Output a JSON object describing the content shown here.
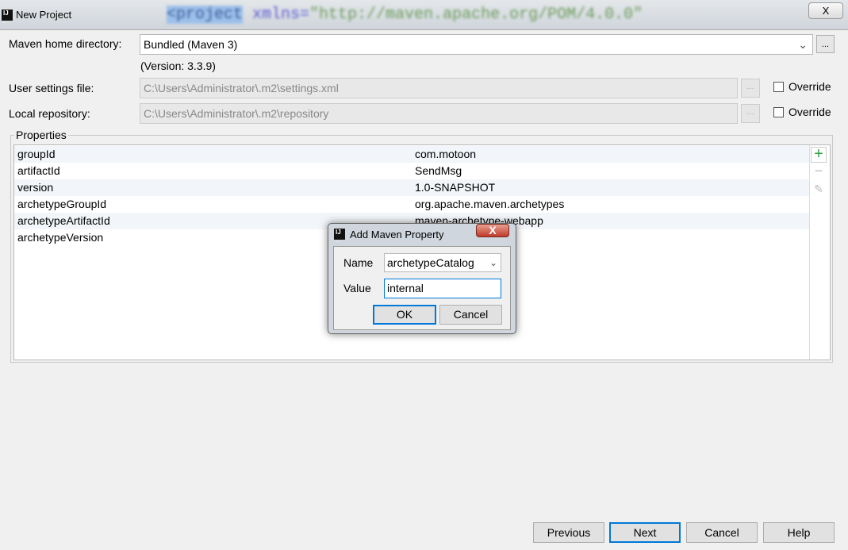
{
  "window": {
    "title": "New Project",
    "icon": "intellij-icon",
    "background_code": {
      "tag": "<project",
      "attr": " xmlns=",
      "value": "\"http://maven.apache.org/POM/4.0.0\""
    },
    "close_label": "X"
  },
  "form": {
    "maven_home": {
      "label": "Maven home directory:",
      "value": "Bundled (Maven 3)",
      "version": "(Version: 3.3.9)",
      "browse": "..."
    },
    "user_settings": {
      "label": "User settings file:",
      "value": "C:\\Users\\Administrator\\.m2\\settings.xml",
      "browse": "...",
      "override": "Override",
      "checked": false
    },
    "local_repo": {
      "label": "Local repository:",
      "value": "C:\\Users\\Administrator\\.m2\\repository",
      "browse": "...",
      "override": "Override",
      "checked": false
    }
  },
  "properties": {
    "title": "Properties",
    "rows": [
      {
        "name": "groupId",
        "value": "com.motoon"
      },
      {
        "name": "artifactId",
        "value": "SendMsg"
      },
      {
        "name": "version",
        "value": "1.0-SNAPSHOT"
      },
      {
        "name": "archetypeGroupId",
        "value": "org.apache.maven.archetypes"
      },
      {
        "name": "archetypeArtifactId",
        "value": "maven-archetype-webapp"
      },
      {
        "name": "archetypeVersion",
        "value": ""
      }
    ],
    "add_color": "#2ea043"
  },
  "dialog": {
    "title": "Add Maven Property",
    "name_label": "Name",
    "name_value": "archetypeCatalog",
    "value_label": "Value",
    "value_value": "internal",
    "ok": "OK",
    "cancel": "Cancel",
    "close_label": "X"
  },
  "footer": {
    "previous": "Previous",
    "next": "Next",
    "cancel": "Cancel",
    "help": "Help"
  }
}
